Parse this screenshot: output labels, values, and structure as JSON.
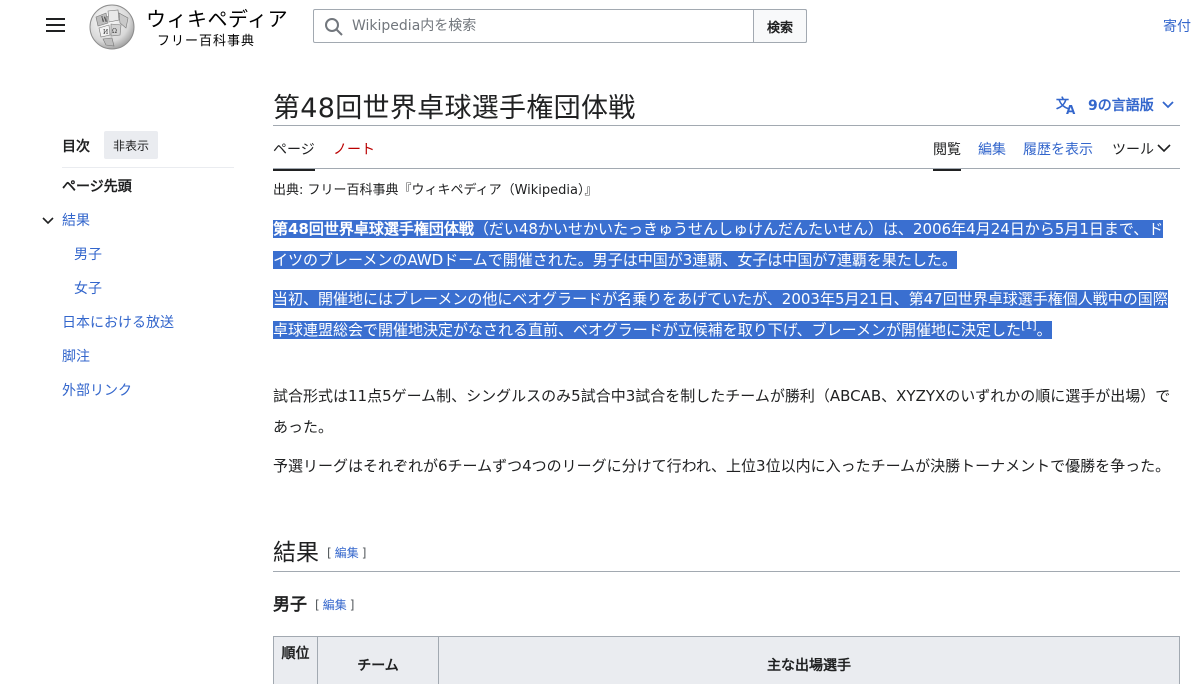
{
  "header": {
    "wordmark": "ウィキペディア",
    "tagline": "フリー百科事典",
    "search_placeholder": "Wikipedia内を検索",
    "search_button": "検索",
    "donate": "寄付"
  },
  "toc": {
    "title": "目次",
    "hide_button": "非表示",
    "items": [
      {
        "label": "ページ先頭"
      },
      {
        "label": "結果"
      },
      {
        "label": "男子"
      },
      {
        "label": "女子"
      },
      {
        "label": "日本における放送"
      },
      {
        "label": "脚注"
      },
      {
        "label": "外部リンク"
      }
    ]
  },
  "page": {
    "title": "第48回世界卓球選手権団体戦",
    "languages": "9の言語版",
    "tabs": {
      "page": "ページ",
      "talk": "ノート",
      "read": "閲覧",
      "edit": "編集",
      "history": "履歴を表示",
      "tools": "ツール"
    },
    "source": "出典: フリー百科事典『ウィキペディア（Wikipedia）』"
  },
  "article": {
    "p1_bold": "第48回世界卓球選手権団体戦",
    "p1_text": "（だい48かいせかいたっきゅうせんしゅけんだんたいせん）は、2006年4月24日から5月1日まで、ドイツのブレーメンのAWDドームで開催された。男子は中国が3連覇、女子は中国が7連覇を果たした。",
    "p2_text": "当初、開催地にはブレーメンの他にベオグラードが名乗りをあげていたが、2003年5月21日、第47回世界卓球選手権個人戦中の国際卓球連盟総会で開催地決定がなされる直前、ベオグラードが立候補を取り下げ、ブレーメンが開催地に決定した",
    "p2_ref": "[1]",
    "p2_end": "。",
    "p3_text": "試合形式は11点5ゲーム制、シングルスのみ5試合中3試合を制したチームが勝利（ABCAB、XYZYXのいずれかの順に選手が出場）であった。",
    "p4_text": "予選リーグはそれぞれが6チームずつ4つのリーグに分けて行われ、上位3位以内に入ったチームが決勝トーナメントで優勝を争った。",
    "h2": "結果",
    "h3": "男子",
    "edit_label": "編集",
    "table_headers": [
      "順位",
      "チーム",
      "主な出場選手"
    ]
  }
}
